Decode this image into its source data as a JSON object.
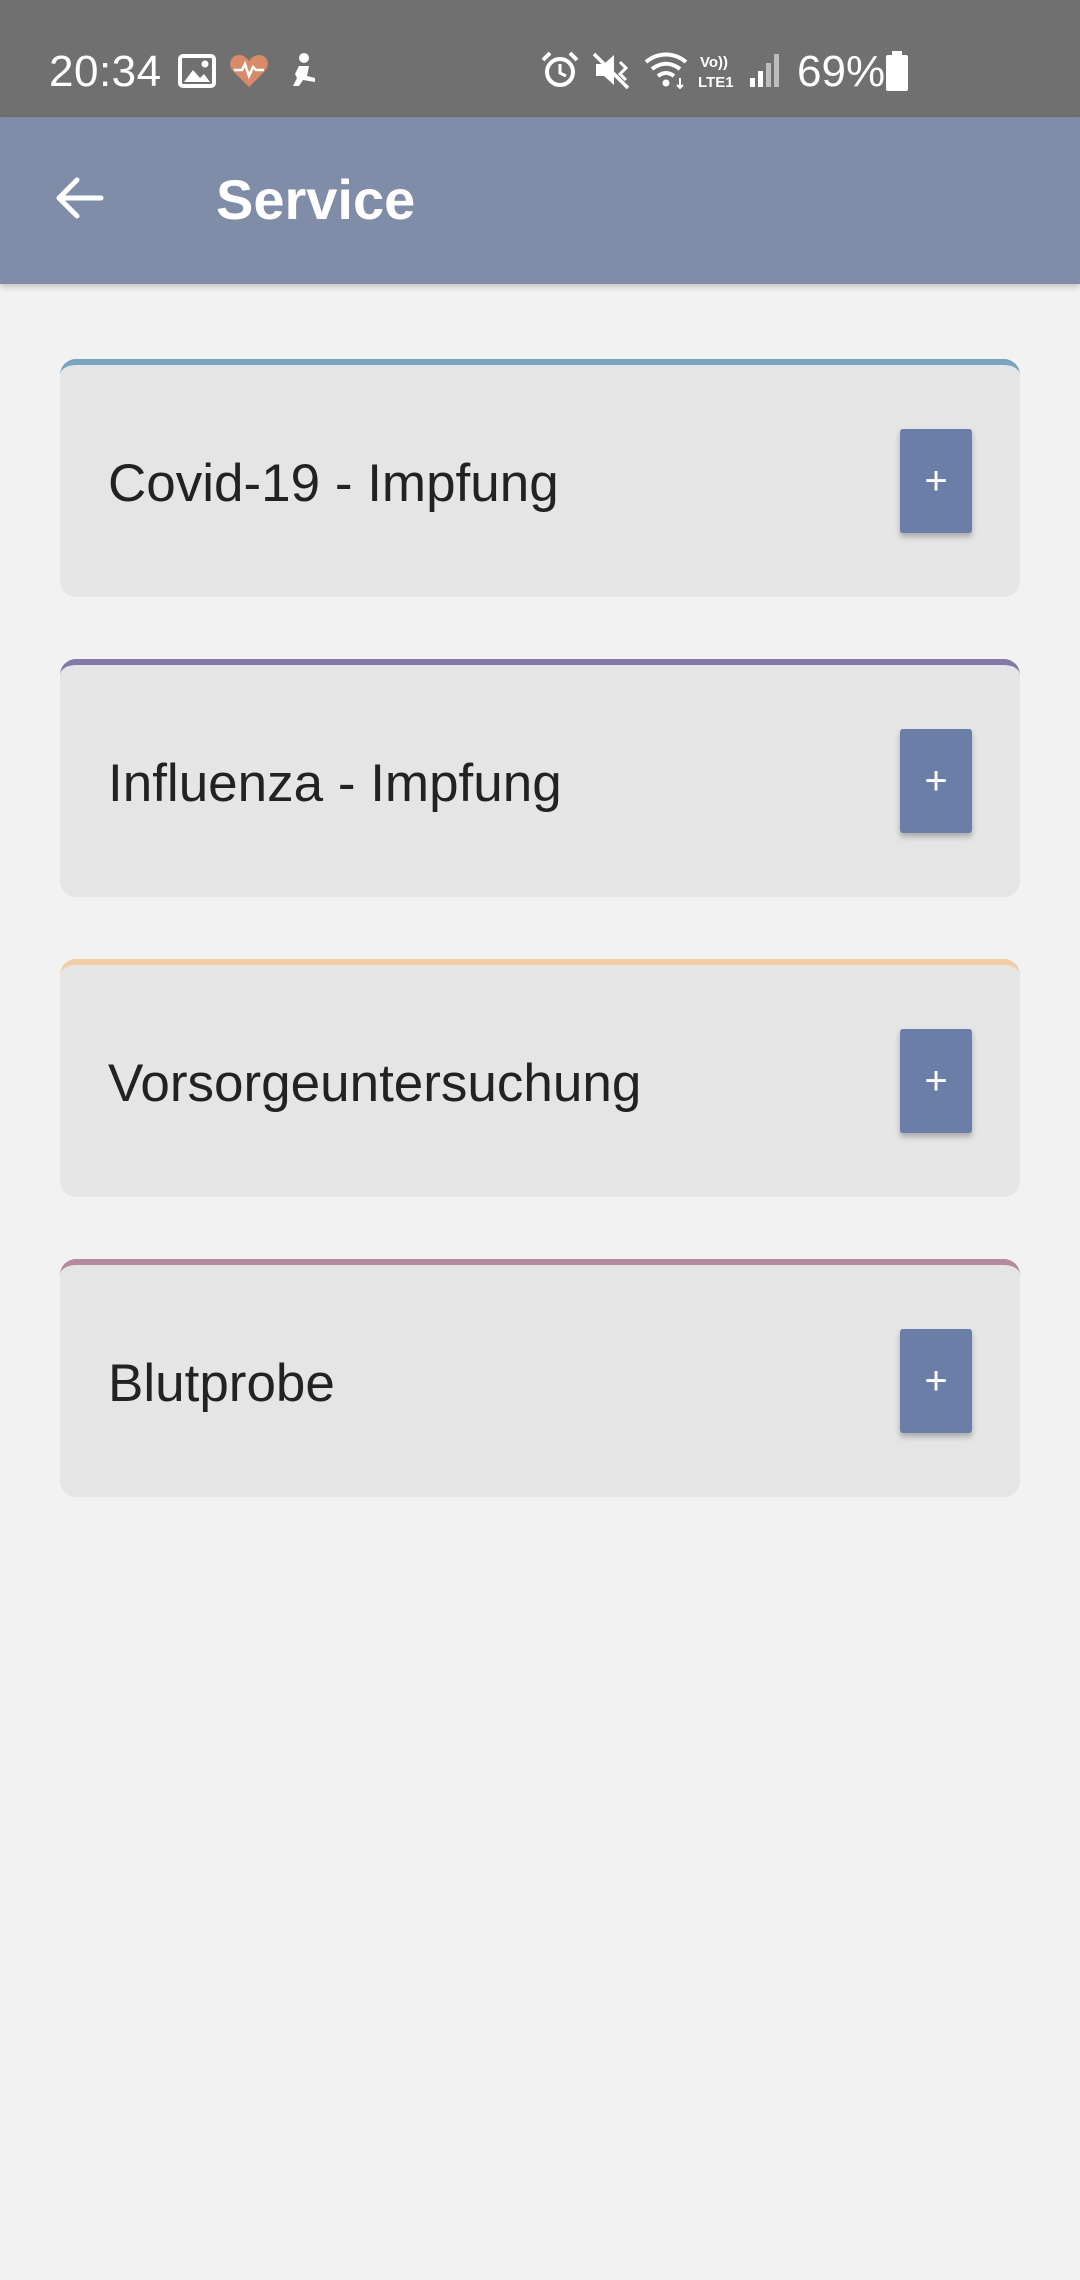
{
  "status_bar": {
    "time": "20:34",
    "battery_percent": "69%",
    "left_icons": [
      "image-icon",
      "health-heart-icon",
      "accessibility-person-icon"
    ],
    "right_icons": [
      "alarm-icon",
      "vibrate-mute-icon",
      "wifi-icon",
      "volte-lte-icon",
      "signal-icon",
      "battery-icon"
    ]
  },
  "app_bar": {
    "title": "Service",
    "back_icon": "arrow-left-icon",
    "color": "#7f8da8"
  },
  "services": [
    {
      "label": "Covid-19 - Impfung",
      "accent_color": "#7aa3bd",
      "button_label": "+"
    },
    {
      "label": "Influenza - Impfung",
      "accent_color": "#8478a8",
      "button_label": "+"
    },
    {
      "label": "Vorsorgeuntersuchung",
      "accent_color": "#f2cfa3",
      "button_label": "+"
    },
    {
      "label": "Blutprobe",
      "accent_color": "#b48a9e",
      "button_label": "+"
    }
  ],
  "colors": {
    "background": "#f2f2f2",
    "card_background": "#e5e5e5",
    "add_button": "#6a7ea8",
    "status_bar": "#707070"
  }
}
